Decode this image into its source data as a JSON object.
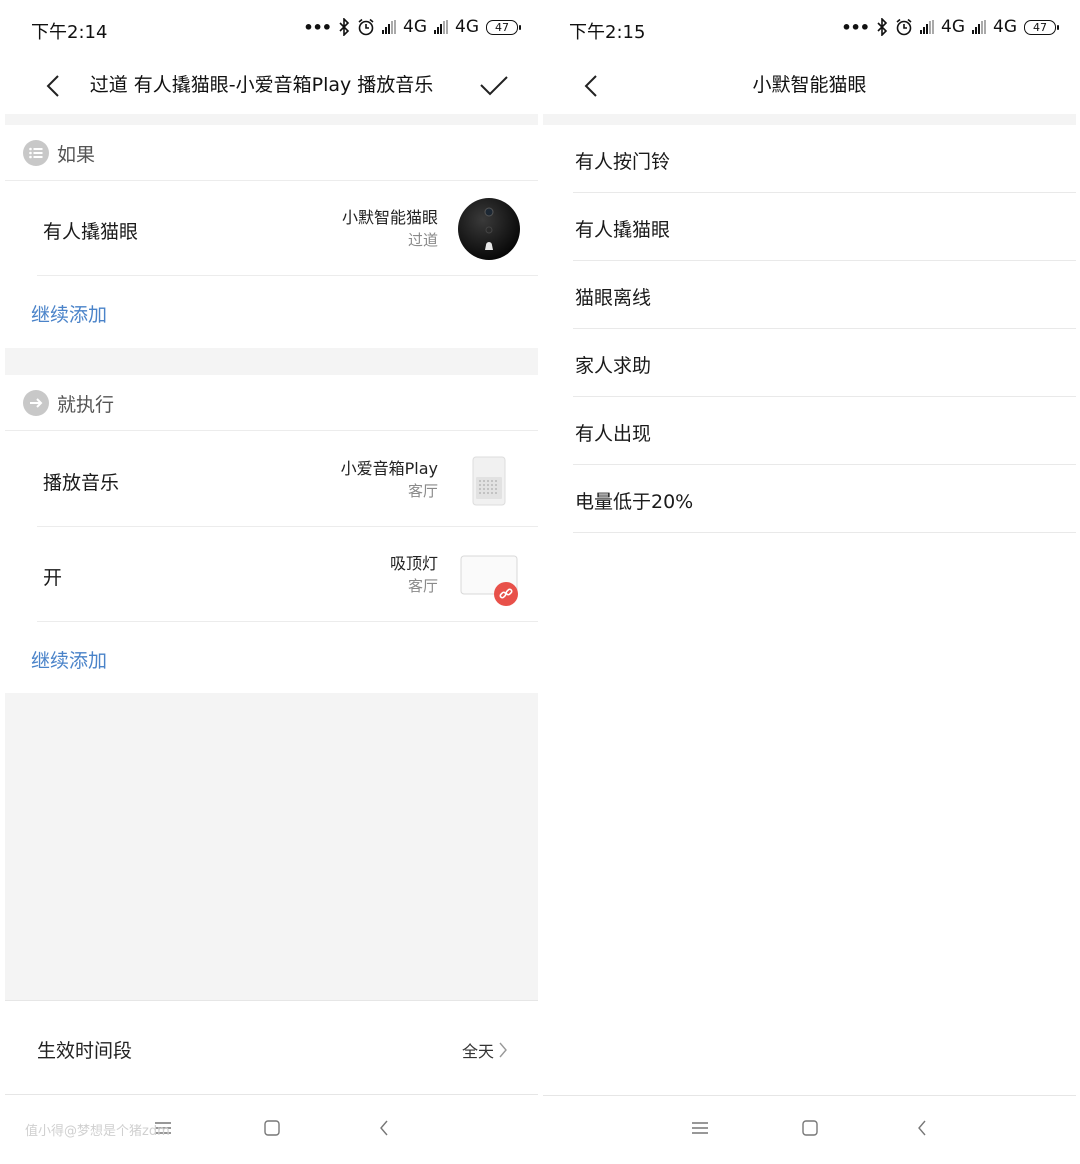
{
  "left": {
    "status": {
      "time": "下午2:14",
      "network1": "4G",
      "network2": "4G",
      "battery": "47"
    },
    "header": {
      "title": "过道 有人撬猫眼-小爱音箱Play 播放音乐"
    },
    "if_section": {
      "title": "如果",
      "items": [
        {
          "label": "有人撬猫眼",
          "device": "小默智能猫眼",
          "room": "过道"
        }
      ],
      "add_label": "继续添加"
    },
    "then_section": {
      "title": "就执行",
      "items": [
        {
          "label": "播放音乐",
          "device": "小爱音箱Play",
          "room": "客厅"
        },
        {
          "label": "开",
          "device": "吸顶灯",
          "room": "客厅"
        }
      ],
      "add_label": "继续添加"
    },
    "effective_period": {
      "label": "生效时间段",
      "value": "全天"
    },
    "watermark": "值小得@梦想是个猪zdm"
  },
  "right": {
    "status": {
      "time": "下午2:15",
      "network1": "4G",
      "network2": "4G",
      "battery": "47"
    },
    "header": {
      "title": "小默智能猫眼"
    },
    "options": [
      {
        "label": "有人按门铃"
      },
      {
        "label": "有人撬猫眼"
      },
      {
        "label": "猫眼离线"
      },
      {
        "label": "家人求助"
      },
      {
        "label": "有人出现"
      },
      {
        "label": "电量低于20%"
      }
    ]
  },
  "colors": {
    "link": "#4a83c9",
    "badge": "#e8514a",
    "gray_bg": "#f4f4f4"
  },
  "icons": [
    "back-icon",
    "check-icon",
    "list-icon",
    "arrow-right-icon",
    "chevron-right-icon",
    "menu-icon",
    "home-icon",
    "nav-back-icon",
    "bluetooth-icon",
    "alarm-icon",
    "link-badge-icon"
  ]
}
